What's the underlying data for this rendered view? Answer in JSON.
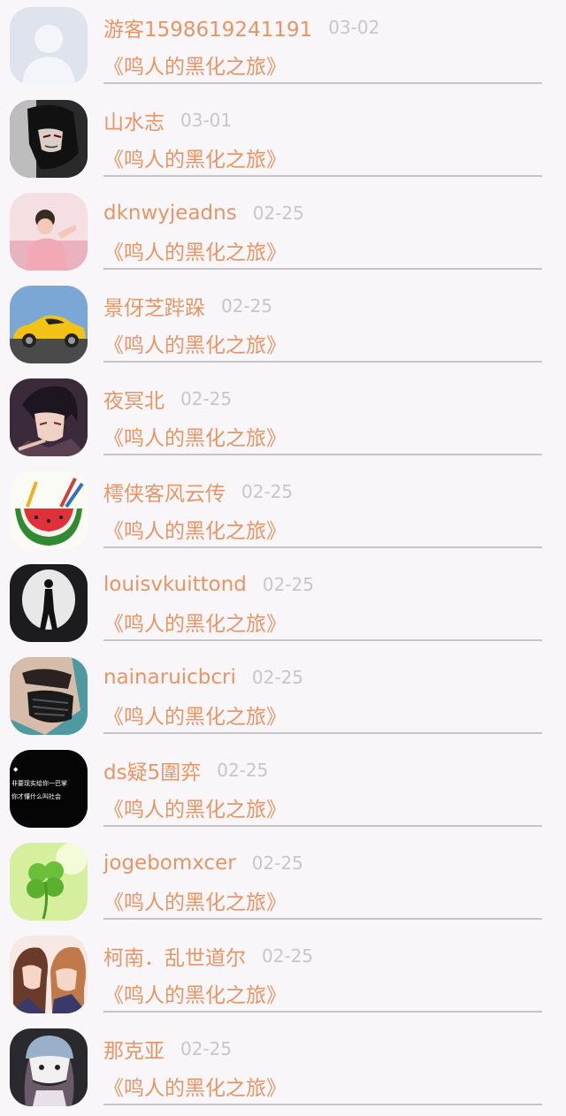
{
  "comments": [
    {
      "user": "游客1598619241191",
      "date": "03-02",
      "book": "《鸣人的黑化之旅》",
      "avatar_icon": "default-person-avatar"
    },
    {
      "user": "山水志",
      "date": "03-01",
      "book": "《鸣人的黑化之旅》",
      "avatar_icon": "dark-anime-character-avatar"
    },
    {
      "user": "dknwyjeadns",
      "date": "02-25",
      "book": "《鸣人的黑化之旅》",
      "avatar_icon": "pink-girl-avatar"
    },
    {
      "user": "景伢芝跸跺",
      "date": "02-25",
      "book": "《鸣人的黑化之旅》",
      "avatar_icon": "yellow-sports-car-avatar"
    },
    {
      "user": "夜冥北",
      "date": "02-25",
      "book": "《鸣人的黑化之旅》",
      "avatar_icon": "anime-boy-avatar"
    },
    {
      "user": "樗侠客风云传",
      "date": "02-25",
      "book": "《鸣人的黑化之旅》",
      "avatar_icon": "watermelon-avatar"
    },
    {
      "user": "louisvkuittond",
      "date": "02-25",
      "book": "《鸣人的黑化之旅》",
      "avatar_icon": "silhouette-spotlight-avatar"
    },
    {
      "user": "nainaruicbcri",
      "date": "02-25",
      "book": "《鸣人的黑化之旅》",
      "avatar_icon": "masked-man-avatar"
    },
    {
      "user": "ds疑5圍弈",
      "date": "02-25",
      "book": "《鸣人的黑化之旅》",
      "avatar_icon": "black-text-avatar",
      "avatar_text": [
        "◆",
        "非要现实给你一巴掌",
        "你才懂什么叫社会"
      ]
    },
    {
      "user": "jogebomxcer",
      "date": "02-25",
      "book": "《鸣人的黑化之旅》",
      "avatar_icon": "clover-avatar"
    },
    {
      "user": "柯南．乱世道尔",
      "date": "02-25",
      "book": "《鸣人的黑化之旅》",
      "avatar_icon": "anime-couple-avatar"
    },
    {
      "user": "那克亚",
      "date": "02-25",
      "book": "《鸣人的黑化之旅》",
      "avatar_icon": "cartoon-girl-hat-avatar"
    }
  ],
  "colors": {
    "background": "#f8f6f8",
    "accent": "#e79566",
    "date": "#c9c6c9",
    "divider": "#c5c5c5"
  }
}
